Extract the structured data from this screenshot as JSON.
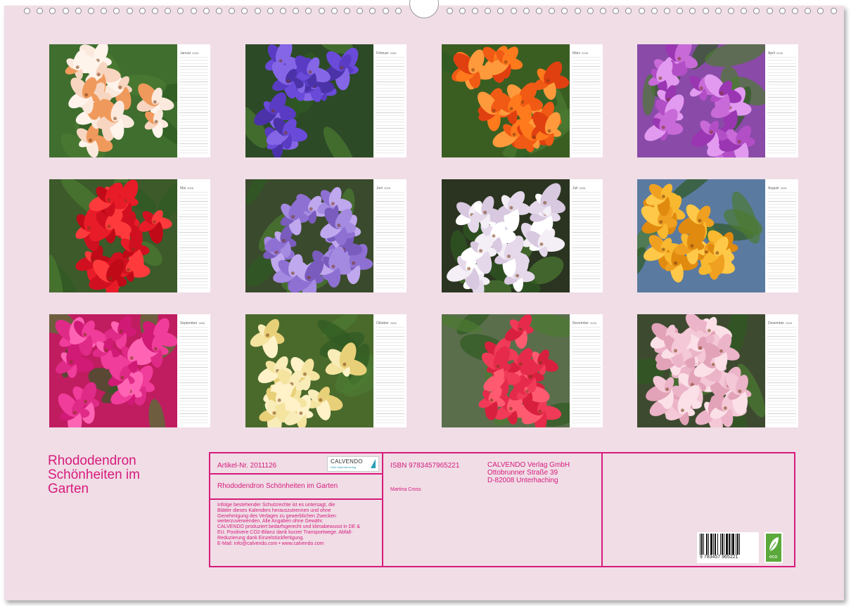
{
  "calendar": {
    "months": [
      {
        "name": "Januar",
        "year": "2026"
      },
      {
        "name": "Februar",
        "year": "2026"
      },
      {
        "name": "März",
        "year": "2026"
      },
      {
        "name": "April",
        "year": "2026"
      },
      {
        "name": "Mai",
        "year": "2026"
      },
      {
        "name": "Juni",
        "year": "2026"
      },
      {
        "name": "Juli",
        "year": "2026"
      },
      {
        "name": "August",
        "year": "2026"
      },
      {
        "name": "September",
        "year": "2026"
      },
      {
        "name": "Oktober",
        "year": "2026"
      },
      {
        "name": "November",
        "year": "2026"
      },
      {
        "name": "Dezember",
        "year": "2026"
      }
    ]
  },
  "title": {
    "line1": "Rhododendron",
    "line2": "Schönheiten im",
    "line3": "Garten"
  },
  "info": {
    "article": "Artikel-Nr. 2011126",
    "logo_text": "CALVENDO",
    "logo_sub": "Dein Kalenderverlag",
    "full_title": "Rhododendron Schönheiten im Garten",
    "legal": [
      "Infolge bestehender Schutzrechte ist es untersagt, die",
      "Blätter dieses Kalenders herauszutrennen und ohne",
      "Genehmigung des Verlages zu gewerblichen Zwecken",
      "weiterzuverwenden. Alle Angaben ohne Gewähr.",
      "CALVENDO produziert bedarfsgerecht und klimabewusst in DE &",
      "EU. Positivere CO2-Bilanz dank kurzer Transportwege. Abfall-",
      "Reduzierung dank Einzelstückfertigung.",
      "E-Mail: info@calvendo.com • www.calvendo.com"
    ],
    "isbn": "ISBN 9783457965221",
    "author": "Martina Cross",
    "publisher": [
      "CALVENDO Verlag GmbH",
      "Ottobrunner Straße 39",
      "D-82008 Unterhaching"
    ],
    "barcode_digits": "9 783457 965221",
    "eco_label": "eco"
  }
}
